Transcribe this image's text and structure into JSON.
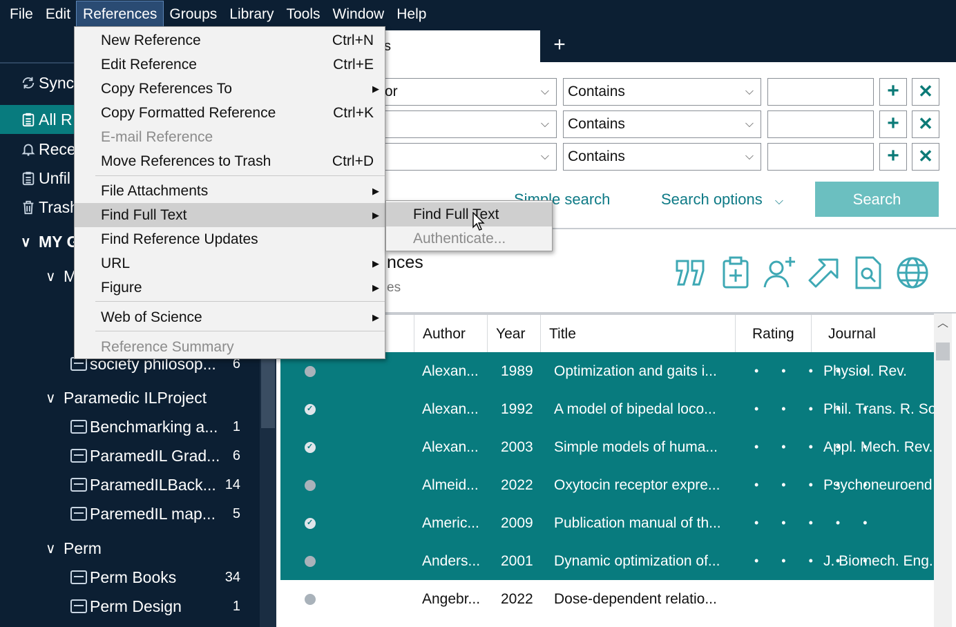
{
  "menubar": {
    "items": [
      "File",
      "Edit",
      "References",
      "Groups",
      "Library",
      "Tools",
      "Window",
      "Help"
    ],
    "active": "References"
  },
  "tabs": {
    "active_label": "s",
    "add_label": "+"
  },
  "sidebar": {
    "sync": "Sync",
    "all_references": "All R",
    "recent": "Rece",
    "unfiled": "Unfil",
    "trash": "Trash",
    "my_groups": "MY G",
    "subgroup_collapsed": "M",
    "groups": [
      {
        "label": "society philosop...",
        "count": "6"
      },
      {
        "label": "Paramedic ILProject",
        "count": ""
      },
      {
        "label": "Benchmarking a...",
        "count": "1"
      },
      {
        "label": "ParamedIL Grad...",
        "count": "6"
      },
      {
        "label": "ParamedILBack...",
        "count": "14"
      },
      {
        "label": "ParemedIL map...",
        "count": "5"
      },
      {
        "label": "Perm",
        "count": ""
      },
      {
        "label": "Perm Books",
        "count": "34"
      },
      {
        "label": "Perm Design",
        "count": "1"
      }
    ]
  },
  "search": {
    "rows": [
      {
        "field": "or",
        "condition": "Contains",
        "value": ""
      },
      {
        "field": "",
        "condition": "Contains",
        "value": ""
      },
      {
        "field": "",
        "condition": "Contains",
        "value": ""
      }
    ],
    "simple_search": "Simple search",
    "search_options": "Search options",
    "search_button": "Search"
  },
  "library": {
    "title": "nces",
    "subtitle": "es"
  },
  "toolbar_icons": [
    "quote-icon",
    "clipboard-add-icon",
    "add-user-icon",
    "share-arrow-icon",
    "find-text-icon",
    "globe-icon"
  ],
  "table": {
    "headers": [
      "Author",
      "Year",
      "Title",
      "Rating",
      "Journal"
    ],
    "rows": [
      {
        "author": "Alexan...",
        "year": "1989",
        "title": "Optimization and gaits i...",
        "rating": "• • • • •",
        "journal": "Physiol. Rev.",
        "selected": true,
        "read": false
      },
      {
        "author": "Alexan...",
        "year": "1992",
        "title": "A model of bipedal loco...",
        "rating": "• • • • •",
        "journal": "Phil. Trans. R. Soc",
        "selected": true,
        "read": true
      },
      {
        "author": "Alexan...",
        "year": "2003",
        "title": "Simple models of huma...",
        "rating": "• • • • •",
        "journal": "Appl. Mech. Rev.",
        "selected": true,
        "read": true
      },
      {
        "author": "Almeid...",
        "year": "2022",
        "title": "Oxytocin receptor expre...",
        "rating": "• • • • •",
        "journal": "Psychoneuroend",
        "selected": true,
        "read": false
      },
      {
        "author": "Americ...",
        "year": "2009",
        "title": "Publication manual of th...",
        "rating": "• • • • •",
        "journal": "",
        "selected": true,
        "read": true
      },
      {
        "author": "Anders...",
        "year": "2001",
        "title": "Dynamic optimization of...",
        "rating": "• • • • •",
        "journal": "J. Biomech. Eng.",
        "selected": true,
        "read": false
      },
      {
        "author": "Angebr...",
        "year": "2022",
        "title": "Dose-dependent relatio...",
        "rating": "",
        "journal": "",
        "selected": false,
        "read": false
      }
    ]
  },
  "references_menu": {
    "items": [
      {
        "label": "New Reference",
        "shortcut": "Ctrl+N",
        "submenu": false,
        "disabled": false
      },
      {
        "label": "Edit Reference",
        "shortcut": "Ctrl+E",
        "submenu": false,
        "disabled": false
      },
      {
        "label": "Copy References To",
        "shortcut": "",
        "submenu": true,
        "disabled": false
      },
      {
        "label": "Copy Formatted Reference",
        "shortcut": "Ctrl+K",
        "submenu": false,
        "disabled": false
      },
      {
        "label": "E-mail Reference",
        "shortcut": "",
        "submenu": false,
        "disabled": true
      },
      {
        "label": "Move References to Trash",
        "shortcut": "Ctrl+D",
        "submenu": false,
        "disabled": false
      },
      {
        "label": "File Attachments",
        "shortcut": "",
        "submenu": true,
        "disabled": false
      },
      {
        "label": "Find Full Text",
        "shortcut": "",
        "submenu": true,
        "disabled": false
      },
      {
        "label": "Find Reference Updates",
        "shortcut": "",
        "submenu": false,
        "disabled": false
      },
      {
        "label": "URL",
        "shortcut": "",
        "submenu": true,
        "disabled": false
      },
      {
        "label": "Figure",
        "shortcut": "",
        "submenu": true,
        "disabled": false
      },
      {
        "label": "Web of Science",
        "shortcut": "",
        "submenu": true,
        "disabled": false
      },
      {
        "label": "Reference Summary",
        "shortcut": "",
        "submenu": false,
        "disabled": true
      }
    ]
  },
  "find_full_text_submenu": {
    "items": [
      {
        "label": "Find Full Text",
        "disabled": false
      },
      {
        "label": "Authenticate...",
        "disabled": true
      }
    ]
  }
}
